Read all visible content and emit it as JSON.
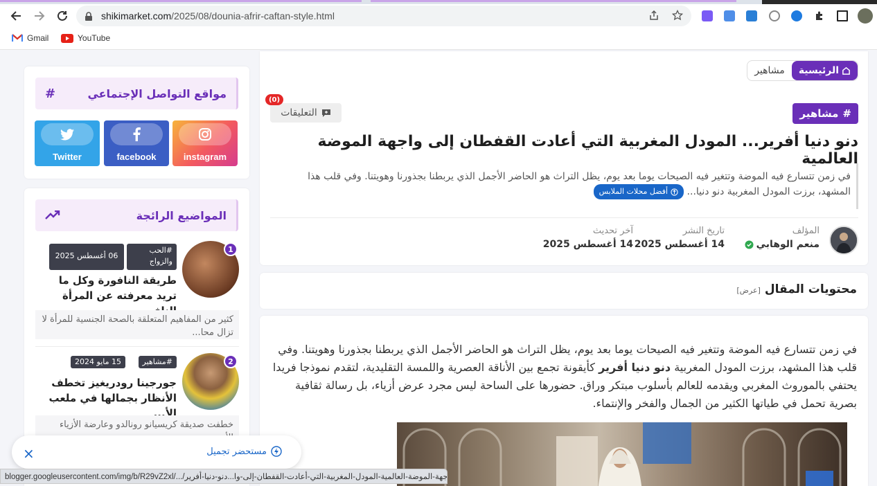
{
  "browser": {
    "url_domain": "shikimarket.com",
    "url_path": "/2025/08/dounia-afrir-caftan-style.html",
    "bookmarks": [
      "Gmail",
      "YouTube"
    ],
    "status_url": "blogger.googleusercontent.com/img/b/R29vZ2xl/.../جهة-الموضة-العالمية-المودل-المغربية-التي-أعادت-القفطان-إلى-وا...دنو-دنيا-أفرير.jpg"
  },
  "article": {
    "breadcrumb": {
      "home": "الرئيسية",
      "category": "مشاهير"
    },
    "category_badge": "مشاهير",
    "comments_label": "التعليقات",
    "comments_count": "(0)",
    "title": "دنو دنيا أفرير... المودل المغربية التي أعادت القفطان إلى واجهة الموضة العالمية",
    "excerpt": "في زمن تتسارع فيه الموضة وتتغير فيه الصيحات يوما بعد يوم، يظل التراث هو الحاضر الأجمل الذي يربطنا بجذورنا وهويتنا. وفي قلب هذا المشهد، برزت المودل المغربية دنو دنيا...",
    "more_button": "أفضل محلات الملابس",
    "author_label": "المؤلف",
    "author_name": "منعم الوهابي",
    "published_label": "تاريخ النشر",
    "published_date": "14 أغسطس 2025",
    "updated_label": "آخر تحديث",
    "updated_date": "14 أغسطس 2025"
  },
  "toc": {
    "title": "محتويات المقال",
    "toggle": "[عرض]"
  },
  "content": {
    "p1_before": "في زمن تتسارع فيه الموضة وتتغير فيه الصيحات يوما بعد يوم، يظل التراث هو الحاضر الأجمل الذي يربطنا بجذورنا وهويتنا. وفي قلب هذا المشهد، برزت المودل المغربية ",
    "p1_bold": "دنو دنيا أفرير",
    "p1_after": " كأيقونة تجمع بين الأناقة العصرية واللمسة التقليدية، لتقدم نموذجا فريدا يحتفي بالموروث المغربي ويقدمه للعالم بأسلوب مبتكر وراق. حضورها على الساحة ليس مجرد عرض أزياء، بل رسالة ثقافية بصرية تحمل في طياتها الكثير من الجمال والفخر والإنتماء."
  },
  "sidebar": {
    "social_title": "مواقع التواصل الإجتماعي",
    "social": [
      {
        "name": "instagram",
        "color": "#f7803b"
      },
      {
        "name": "facebook",
        "color": "#3b5ec4"
      },
      {
        "name": "Twitter",
        "color": "#33a4e8"
      }
    ],
    "trending_title": "المواضيع الرائجة",
    "trending": [
      {
        "rank": "1",
        "tag": "#الحب والزواج",
        "date": "06 أغسطس 2025",
        "title": "طريقة النافورة وكل ما تريد معرفته عن المرأة الناف...",
        "excerpt": "كثير من المفاهيم المتعلقة بالصحة الجنسية للمرأة لا تزال محا..."
      },
      {
        "rank": "2",
        "tag": "#مشاهير",
        "date": "15 مايو 2024",
        "title": "جورجينا رودريغيز تخطف الأنظار بجمالها في ملعب الأ...",
        "excerpt": "خطفت صديقة كريسيانو رونالدو وعارضة الأزياء الأرجنتينية جو..."
      }
    ]
  },
  "toast": {
    "message": "مستحضر تجميل",
    "close": "×"
  },
  "colors": {
    "accent": "#6a2fb8",
    "link": "#1966c8",
    "badge_red": "#e42727"
  }
}
